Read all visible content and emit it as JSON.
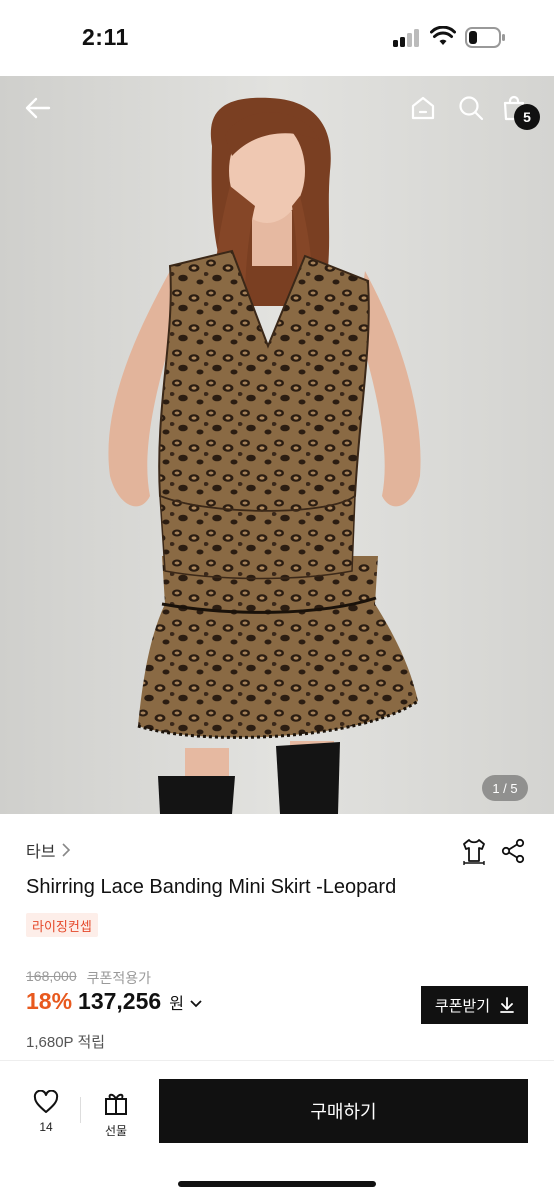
{
  "status_bar": {
    "time": "2:11",
    "signal_icon": "cellular-signal-icon",
    "wifi_icon": "wifi-icon",
    "battery_icon": "battery-low-icon"
  },
  "header": {
    "back_icon": "arrow-left-icon",
    "home_icon": "home-icon",
    "search_icon": "search-icon",
    "cart_icon": "shopping-bag-icon",
    "cart_count": "5"
  },
  "gallery": {
    "counter": "1 / 5",
    "current_image": 1,
    "total_images": 5
  },
  "product": {
    "brand": "타브",
    "brand_chevron": ">",
    "title": "Shirring Lace Banding Mini Skirt -Leopard",
    "tag": "라이징컨셉",
    "original_price": "168,000",
    "coupon_applied_label": "쿠폰적용가",
    "discount": "18%",
    "price": "137,256",
    "currency": "원",
    "points": "1,680P 적립"
  },
  "actions": {
    "coupon_button": "쿠폰받기",
    "like_count": "14",
    "gift_label": "선물",
    "buy_button": "구매하기"
  },
  "colors": {
    "accent": "#e8591e",
    "tag_text": "#e5492b",
    "tag_bg": "#fdeee9",
    "primary_button": "#111111"
  }
}
